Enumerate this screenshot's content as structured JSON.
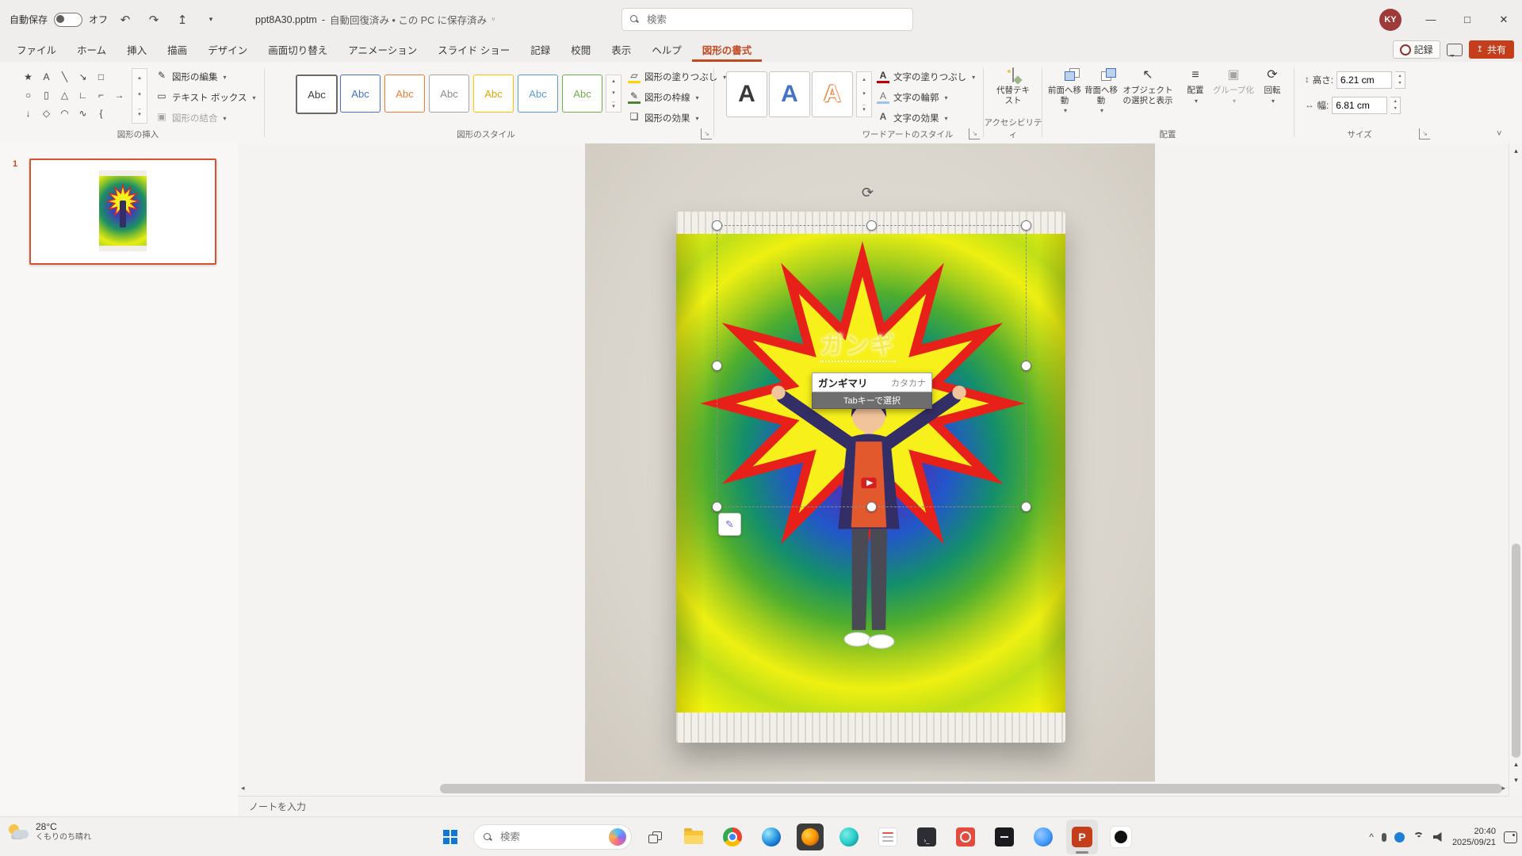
{
  "colors": {
    "accent_red": "#C43E1C",
    "active_tab": "#C24A22",
    "selected_thumb_border": "#D35230",
    "star_red": "#E7211A",
    "star_yellow": "#F8F01A",
    "abc_theme": [
      "#3B3A39",
      "#4472C4",
      "#ED7D31",
      "#8C8C8C",
      "#D8A800",
      "#5B9BD5",
      "#70AD47"
    ]
  },
  "titlebar": {
    "autosave_label": "自動保存",
    "autosave_state": "オフ",
    "filename": "ppt8A30.pptm",
    "title_sep": "-",
    "file_status": "自動回復済み • この PC に保存済み",
    "search_placeholder": "検索",
    "avatar": "KY"
  },
  "tabs": {
    "items": [
      "ファイル",
      "ホーム",
      "挿入",
      "描画",
      "デザイン",
      "画面切り替え",
      "アニメーション",
      "スライド ショー",
      "記録",
      "校閲",
      "表示",
      "ヘルプ",
      "図形の書式"
    ],
    "record": "記録",
    "share": "共有"
  },
  "glyphs": {
    "undo": "↶",
    "redo": "↷",
    "save": "↥",
    "caret": "▾",
    "up": "▴",
    "down": "▾",
    "left": "◂",
    "right": "▸",
    "collapse": "˅",
    "rotate": "⟳",
    "pencil": "✎",
    "pen": "✎",
    "height": "↕",
    "width": "↔",
    "merge": "▣",
    "textbox": "▭",
    "align": "≡",
    "group": "▣",
    "select_cursor": "↖",
    "launcher": "↘",
    "effects": "❏",
    "letter_a": "A",
    "shape_gallery": [
      "★",
      "A",
      "╲",
      "↘",
      "□",
      "○",
      "▯",
      "△",
      "∟",
      "⌐",
      "→",
      "↓",
      "◇",
      "◠",
      "∿",
      "{"
    ]
  },
  "ribbon": {
    "insert_shapes": {
      "label": "図形の挿入",
      "edit": "図形の編集",
      "textbox": "テキスト ボックス",
      "merge": "図形の結合"
    },
    "shape_styles": {
      "label": "図形のスタイル",
      "abc": "Abc",
      "fill": "図形の塗りつぶし",
      "outline": "図形の枠線",
      "effects": "図形の効果"
    },
    "wordart": {
      "label": "ワードアートのスタイル",
      "letter": "A",
      "text_fill": "文字の塗りつぶし",
      "text_outline": "文字の輪郭",
      "text_effects": "文字の効果"
    },
    "accessibility": {
      "label": "アクセシビリティ",
      "alt_text": "代替テキスト"
    },
    "arrange": {
      "label": "配置",
      "bring_forward": "前面へ移動",
      "send_backward": "背面へ移動",
      "selection_pane": "オブジェクトの選択と表示",
      "align": "配置",
      "group": "グループ化",
      "rotate": "回転"
    },
    "size": {
      "label": "サイズ",
      "height_label": "高さ:",
      "height_value": "6.21 cm",
      "width_label": "幅:",
      "width_value": "6.81 cm"
    }
  },
  "slides_panel": {
    "number": "1"
  },
  "slide": {
    "composition_text": "ガンギ",
    "ime": {
      "candidate": "ガンギマリ",
      "category": "カタカナ",
      "hint": "Tabキーで選択"
    }
  },
  "notes": {
    "placeholder": "ノートを入力"
  },
  "taskbar": {
    "weather_temp": "28°C",
    "weather_desc": "くもりのち晴れ",
    "search_placeholder": "検索",
    "terminal_glyph": "›_",
    "ppt_letter": "P",
    "time": "20:40",
    "date": "2025/09/21"
  }
}
